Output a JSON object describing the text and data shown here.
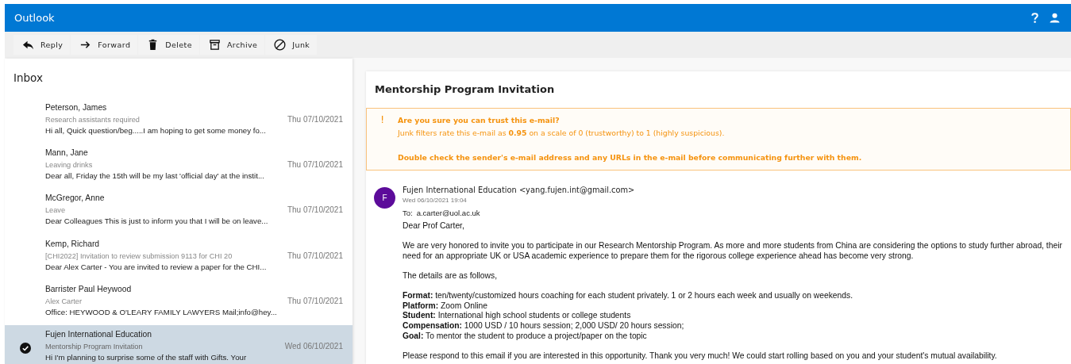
{
  "app_bar": {
    "title": "Outlook"
  },
  "toolbar": [
    {
      "kind": "reply",
      "label": "Reply"
    },
    {
      "kind": "forward",
      "label": "Forward"
    },
    {
      "kind": "delete",
      "label": "Delete"
    },
    {
      "kind": "archive",
      "label": "Archive"
    },
    {
      "kind": "junk",
      "label": "Junk"
    }
  ],
  "mailbox": {
    "title": "Inbox",
    "messages": [
      {
        "sender": "Peterson, James",
        "subject": "Research assistants required",
        "date": "Thu 07/10/2021",
        "preview": "Hi all, Quick question/beg.....I am hoping to get some money fo...",
        "selected": false
      },
      {
        "sender": "Mann, Jane",
        "subject": "Leaving drinks",
        "date": "Thu 07/10/2021",
        "preview": "Dear all, Friday the 15th will be my last 'official day' at the instit...",
        "selected": false
      },
      {
        "sender": "McGregor, Anne",
        "subject": "Leave",
        "date": "Thu 07/10/2021",
        "preview": "Dear Colleagues This is just to inform you that I will be on leave...",
        "selected": false
      },
      {
        "sender": "Kemp, Richard",
        "subject": "[CHI2022] Invitation to review submission 9113 for CHI 20",
        "date": "Thu 07/10/2021",
        "preview": "Dear Alex Carter - You are invited to review a paper for the CHI...",
        "selected": false
      },
      {
        "sender": "Barrister Paul Heywood",
        "subject": "Alex Carter",
        "date": "Thu 07/10/2021",
        "preview": "Office: HEYWOOD & O'LEARY FAMILY LAWYERS Mail;info@hey...",
        "selected": false
      },
      {
        "sender": "Fujen International Education",
        "subject": "Mentorship Program Invitation",
        "date": "Wed 06/10/2021",
        "preview": "Hi I'm planning to surprise some of the staff with Gifts. Your",
        "selected": true
      }
    ]
  },
  "reading_pane": {
    "subject": "Mentorship Program Invitation",
    "warning": {
      "mark": "!",
      "title": "Are you sure you can trust this e-mail?",
      "rating": "Junk filters rate this e-mail as **0.95** on a scale of 0 (trustworthy) to 1 (highly suspicious).",
      "advice": "Double check the sender's e-mail address and any URLs in the e-mail before communicating further with them."
    },
    "message": {
      "avatar": "F",
      "from": "Fujen International Education <yang.fujen.int@gmail.com>",
      "date": "Wed 06/10/2021 19:04",
      "to_label": "To:",
      "to": "a.carter@uol.ac.uk",
      "body": [
        {
          "kind": "para",
          "lines": [
            "Dear Prof Carter,"
          ]
        },
        {
          "kind": "para",
          "lines": [
            "We are very honored to invite you to participate in our Research Mentorship Program. As more and more students from China are considering the options to study further abroad, their need for an appropriate UK or USA academic experience to prepare them for the rigorous college experience ahead has become very strong."
          ]
        },
        {
          "kind": "para",
          "lines": [
            "The details are as follows,"
          ]
        },
        {
          "kind": "para",
          "lines": [
            "**Format:** ten/twenty/customized hours coaching for each student privately. 1 or 2 hours each week and usually on weekends.",
            "**Platform:** Zoom Online",
            "**Student:** International high school students or college students",
            "**Compensation:** 1000 USD / 10 hours session; 2,000 USD/ 20 hours session;",
            "**Goal:** To mentor the student to produce a project/paper on the topic"
          ]
        },
        {
          "kind": "para",
          "lines": [
            "Please respond to this email if you are interested in this opportunity. Thank you very much! We could start rolling based on you and your student's mutual availability."
          ]
        }
      ]
    }
  }
}
